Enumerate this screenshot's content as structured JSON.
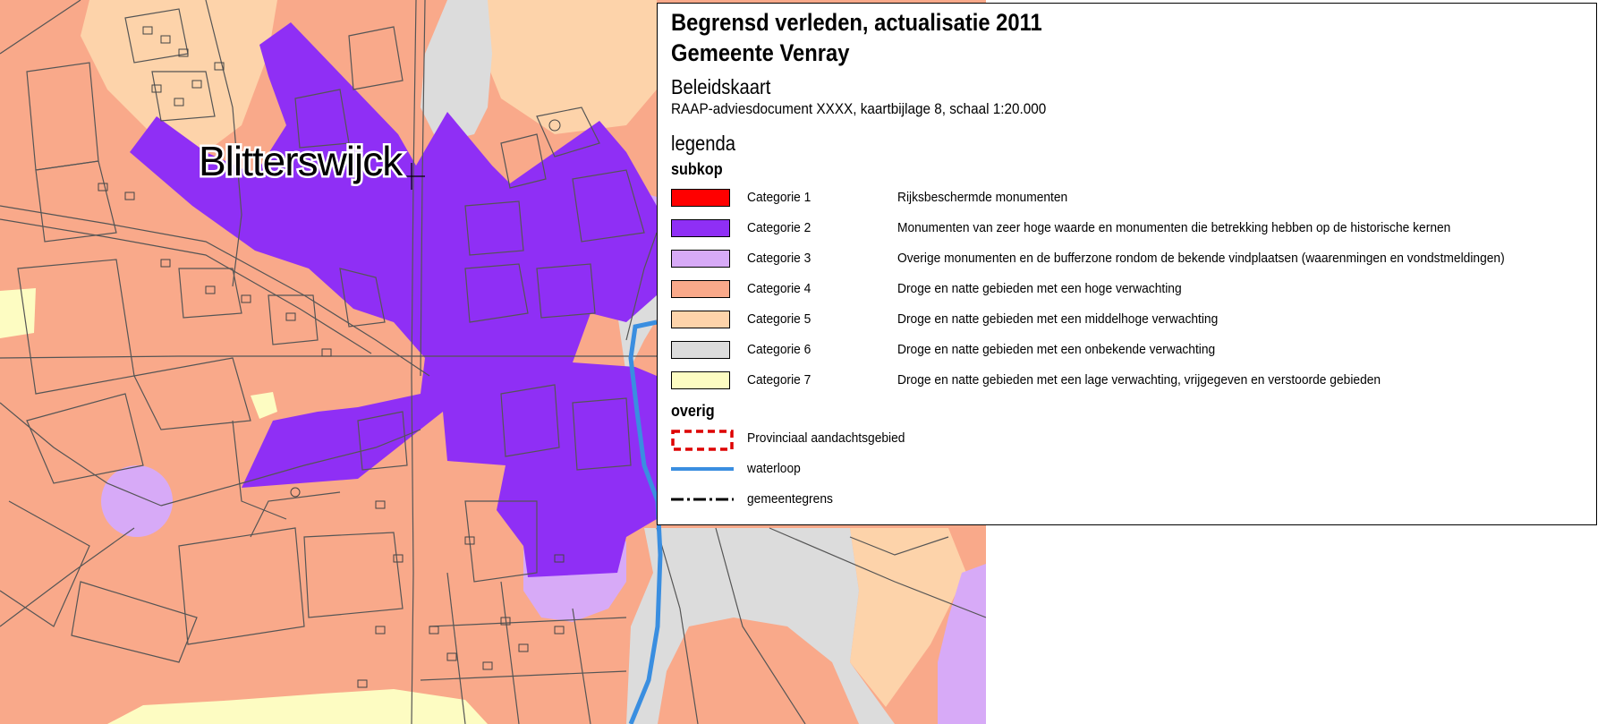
{
  "map": {
    "place_name": "Blitterswijck",
    "colors": {
      "cat1": "#ff0000",
      "cat2": "#8f2ff5",
      "cat3": "#d7aaf7",
      "cat4": "#f9a98a",
      "cat5": "#fdd3aa",
      "cat6": "#dcdcdc",
      "cat7": "#fdfcc2",
      "waterloop": "#3a8ee0",
      "lines": "#555555"
    }
  },
  "legend": {
    "title_line1": "Begrensd verleden, actualisatie 2011",
    "title_line2": "Gemeente Venray",
    "subtitle": "Beleidskaart",
    "document_info": "RAAP-adviesdocument XXXX, kaartbijlage 8, schaal 1:20.000",
    "legend_heading": "legenda",
    "section_subkop": "subkop",
    "categories": [
      {
        "label": "Categorie 1",
        "description": "Rijksbeschermde monumenten",
        "color": "#ff0000"
      },
      {
        "label": "Categorie 2",
        "description": "Monumenten van zeer hoge waarde en monumenten die betrekking hebben op de historische kernen",
        "color": "#8f2ff5"
      },
      {
        "label": "Categorie 3",
        "description": "Overige monumenten en de bufferzone rondom de bekende vindplaatsen (waarenmingen en vondstmeldingen)",
        "color": "#d7aaf7"
      },
      {
        "label": "Categorie 4",
        "description": "Droge en natte gebieden met een hoge verwachting",
        "color": "#f9a98a"
      },
      {
        "label": "Categorie 5",
        "description": "Droge en natte gebieden met een middelhoge verwachting",
        "color": "#fdd3aa"
      },
      {
        "label": "Categorie 6",
        "description": "Droge en natte gebieden met een onbekende verwachting",
        "color": "#dcdcdc"
      },
      {
        "label": "Categorie 7",
        "description": "Droge en natte gebieden met een lage verwachting, vrijgegeven en verstoorde gebieden",
        "color": "#fdfcc2"
      }
    ],
    "section_overig": "overig",
    "other_items": [
      {
        "label": "Provinciaal aandachtsgebied",
        "symbol": "dashed-red-box"
      },
      {
        "label": "waterloop",
        "symbol": "blue-line"
      },
      {
        "label": "gemeentegrens",
        "symbol": "dash-dot-line"
      }
    ]
  }
}
